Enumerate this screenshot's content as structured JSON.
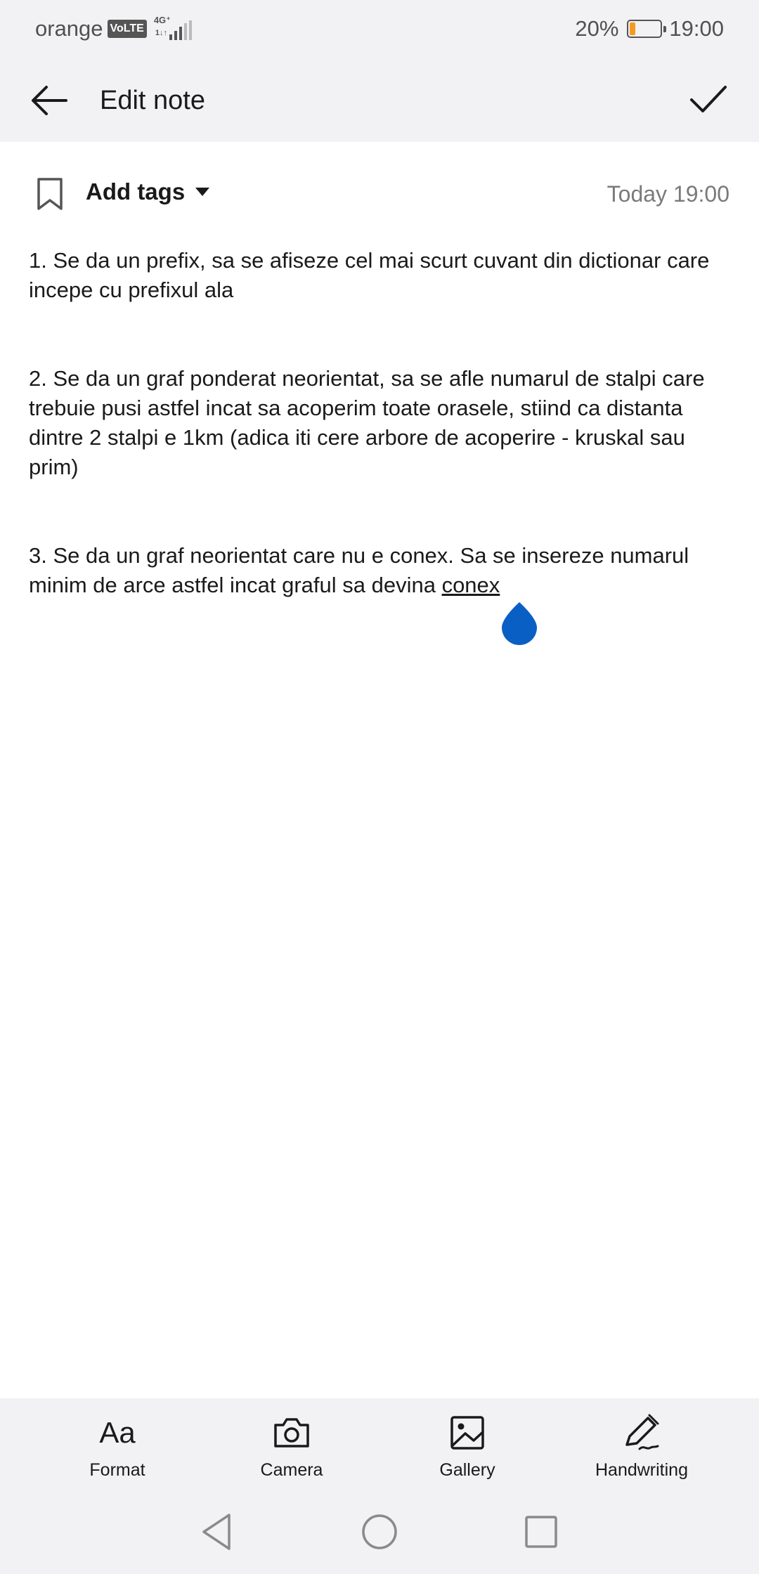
{
  "status_bar": {
    "carrier": "orange",
    "volte": "VoLTE",
    "network": "4G⁺",
    "data_arrows": "1↓↑",
    "battery_percent": "20%",
    "battery_level": 0.2,
    "battery_color": "#f59a23",
    "time": "19:00"
  },
  "app_bar": {
    "back_icon": "arrow-left-icon",
    "title": "Edit note",
    "confirm_icon": "checkmark-icon"
  },
  "tags": {
    "bookmark_icon": "bookmark-icon",
    "label": "Add tags",
    "dropdown_icon": "triangle-down-icon",
    "date": "Today 19:00"
  },
  "note": {
    "paragraphs": [
      "1. Se da un prefix, sa se afiseze cel mai scurt cuvant din dictionar care incepe cu prefixul ala",
      "2. Se da un graf ponderat neorientat, sa se afle numarul de stalpi care trebuie pusi astfel incat sa acoperim toate orasele, stiind ca distanta dintre 2 stalpi e 1km (adica iti cere arbore de acoperire - kruskal sau prim)",
      "3. Se da un graf neorientat care nu e conex. Sa se insereze numarul minim de arce astfel incat graful sa devina "
    ],
    "underlined_word": "conex",
    "cursor_color": "#0a5fc4"
  },
  "toolbar": {
    "format_glyph": "Aa",
    "format_label": "Format",
    "camera_label": "Camera",
    "gallery_label": "Gallery",
    "handwriting_label": "Handwriting"
  },
  "nav": {
    "back_icon": "nav-back-triangle-icon",
    "home_icon": "nav-home-circle-icon",
    "recents_icon": "nav-recents-square-icon"
  }
}
